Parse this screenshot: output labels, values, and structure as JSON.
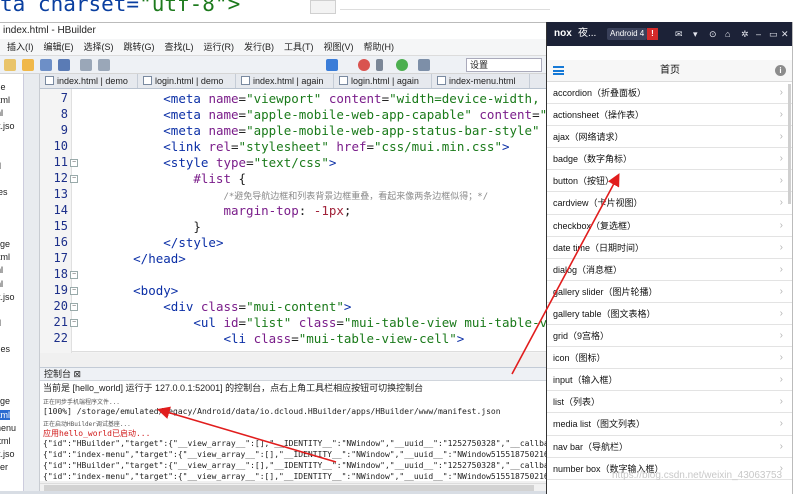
{
  "top_fragment": {
    "code_prefix": "ta charset=",
    "code_value": "\"utf-8\">"
  },
  "hbuilder": {
    "title": "index.html - HBuilder",
    "menu": [
      "插入(I)",
      "编辑(E)",
      "选择(S)",
      "跳转(G)",
      "查找(L)",
      "运行(R)",
      "发行(B)",
      "工具(T)",
      "视图(V)",
      "帮助(H)"
    ],
    "settings_box": "设置",
    "tabs": [
      "index.html | demo",
      "login.html | demo",
      "index.html | again",
      "login.html | again",
      "index-menu.html"
    ],
    "left_tree": [
      "kage",
      "x.html",
      "html",
      "fest.jso",
      "",
      "",
      "orld",
      "",
      "nples",
      "",
      "les",
      "",
      "ckage",
      "x.html",
      "html",
      "html",
      "fest.jso",
      "",
      "orld",
      "",
      "mples",
      "",
      "les",
      "",
      "ckage",
      "x.html",
      "x-menu",
      "n.html",
      "fest.jso",
      "uilder",
      "案"
    ],
    "line_numbers": [
      "7",
      "8",
      "9",
      "10",
      "11",
      "12",
      "13",
      "14",
      "15",
      "16",
      "17",
      "18",
      "19",
      "20",
      "21",
      "22"
    ],
    "comment_text": "/*避免导航边框和列表背景边框重叠，看起来像两条边框似得；*/",
    "console_tab": "控制台",
    "console_message": "当前是 [hello_world] 运行于 127.0.0.1:52001] 的控制台，点右上角工具栏相应按钮可切换控制台",
    "console_lines": [
      "正在同步手机端程序文件...",
      "[100%] /storage/emulated/legacy/Android/data/io.dcloud.HBuilder/apps/HBuilder/www/manifest.json",
      "正在启动HBuilder调试基座...",
      "应用hello_world已启动...",
      "{\"id\":\"HBuilder\",\"target\":{\"__view_array__\":[],\"__IDENTITY__\":\"NWindow\",\"__uuid__\":\"1252750328\",\"__callbacks_",
      "{\"id\":\"index-menu\",\"target\":{\"__view_array__\":[],\"__IDENTITY__\":\"NWindow\",\"__uuid__\":\"NWindow51551875021683\",\"_",
      "{\"id\":\"HBuilder\",\"target\":{\"__view_array__\":[],\"__IDENTITY__\":\"NWindow\",\"__uuid__\":\"1252750328\",\"__callbacks_",
      "{\"id\":\"index-menu\",\"target\":{\"__view_array__\":[],\"__IDENTITY__\":\"NWindow\",\"__uuid__\":\"NWindow51551875021683\",\"_"
    ]
  },
  "nox": {
    "logo": "nox",
    "name": "夜...",
    "android_badge": "Android 4",
    "warning": "!",
    "titlebar_icons": [
      "✉",
      "▾",
      "⊙",
      "⌂",
      "✲",
      "–",
      "▭",
      "✕"
    ],
    "page_title": "首页",
    "info": "i",
    "items": [
      "accordion（折叠面板）",
      "actionsheet（操作表）",
      "ajax（网络请求）",
      "badge（数字角标）",
      "button（按钮）",
      "cardview（卡片视图）",
      "checkbox（复选框）",
      "date time（日期时间）",
      "dialog（消息框）",
      "gallery slider（图片轮播）",
      "gallery table（图文表格）",
      "grid（9宫格）",
      "icon（图标）",
      "input（输入框）",
      "list（列表）",
      "media list（图文列表）",
      "nav bar（导航栏）",
      "number box（数字输入框）"
    ],
    "watermark": "https://blog.csdn.net/weixin_43063753"
  },
  "colors": {
    "arrow": "#e11d1d",
    "nox_titlebar": "#1c2237",
    "accent_blue": "#1679d6",
    "console_red": "#d01818"
  }
}
